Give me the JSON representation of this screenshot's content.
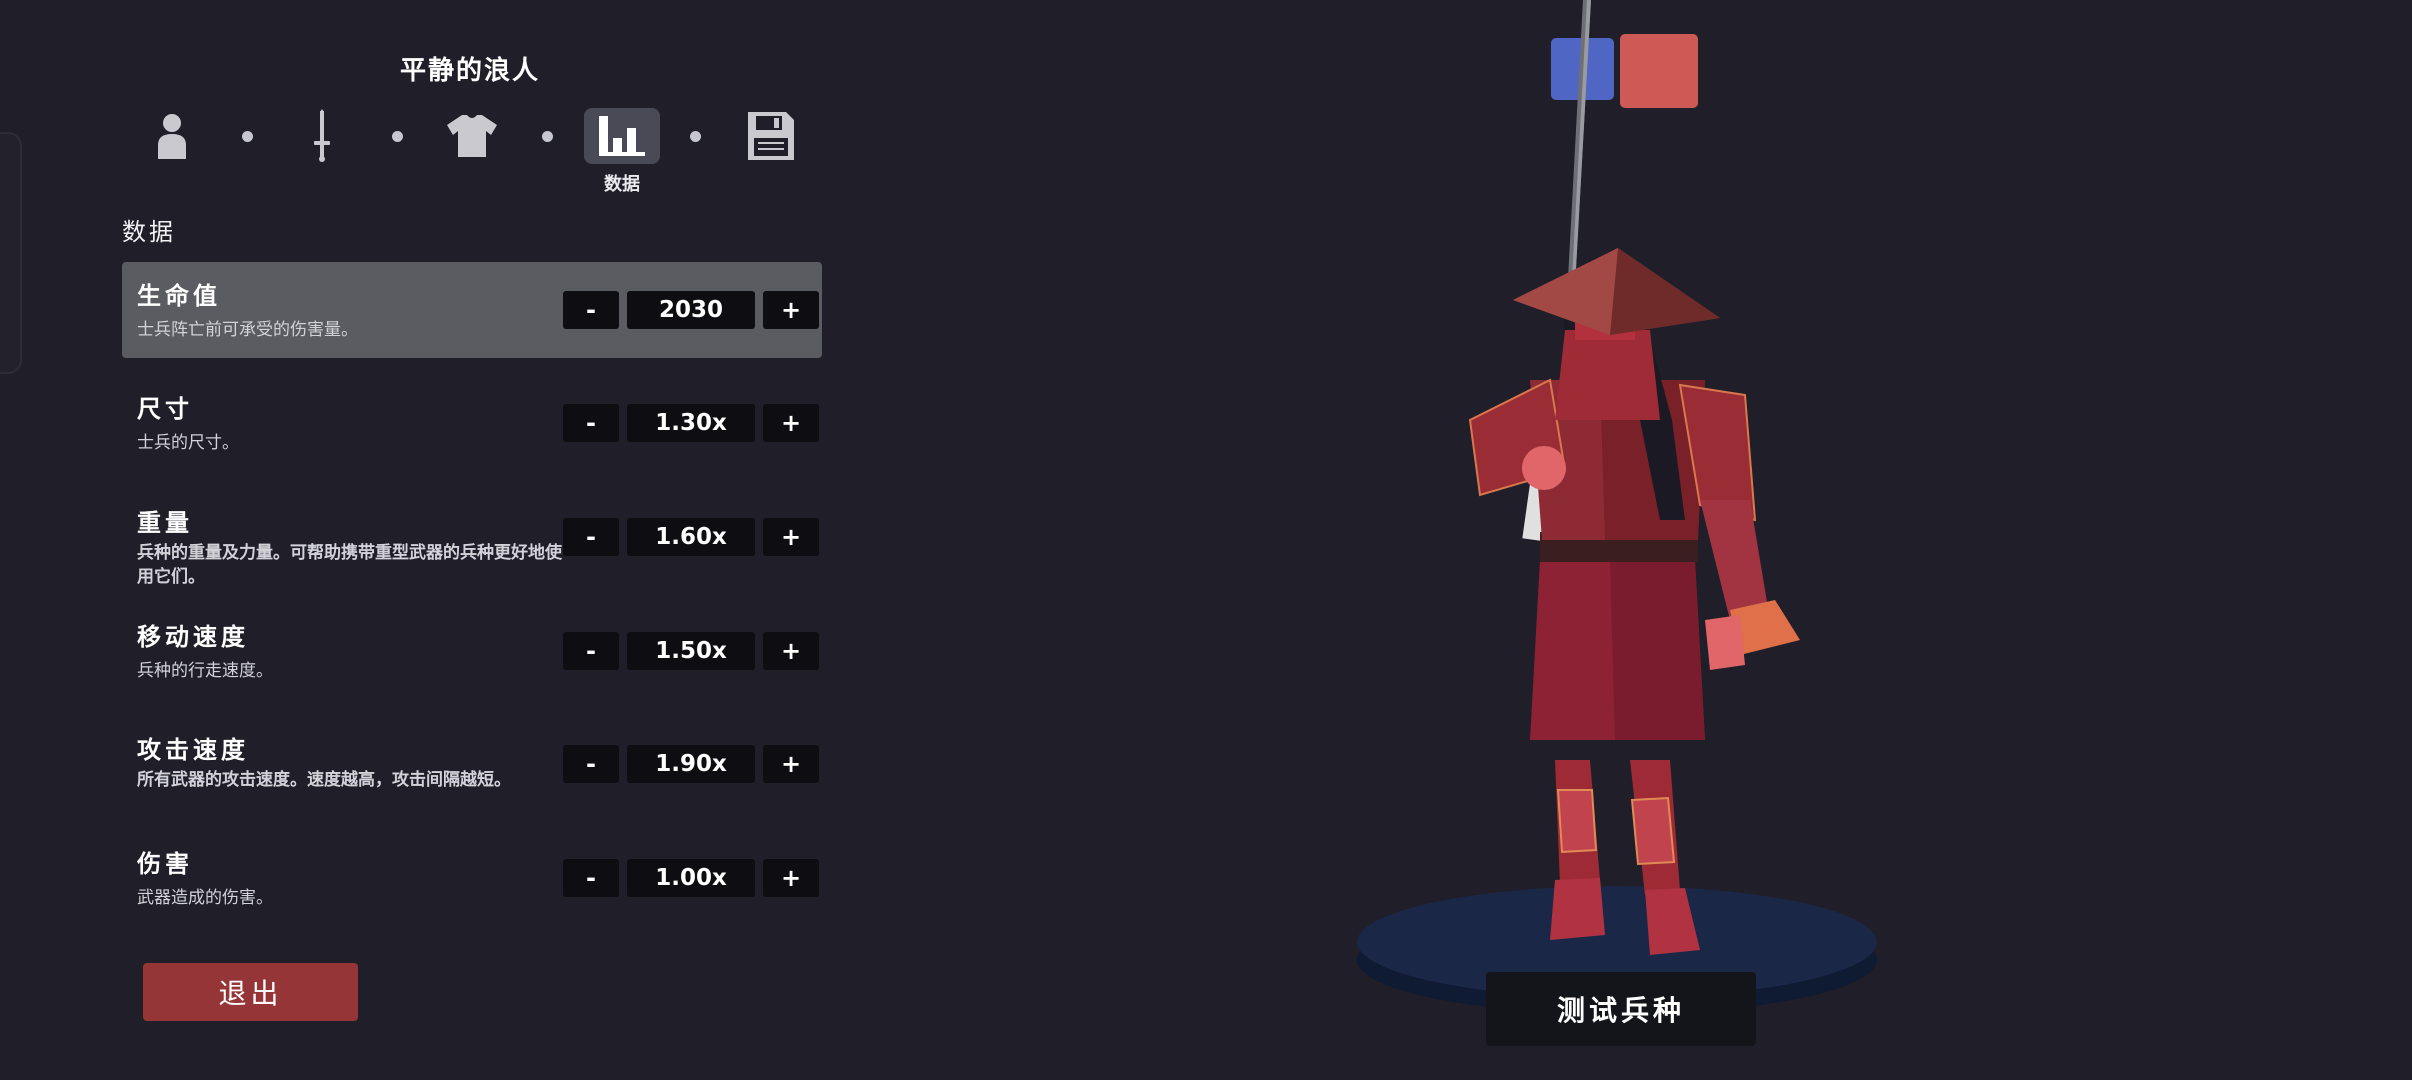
{
  "unit": {
    "title": "平静的浪人"
  },
  "nav": {
    "items": [
      {
        "icon": "person-icon",
        "label": ""
      },
      {
        "icon": "sword-icon",
        "label": ""
      },
      {
        "icon": "shirt-icon",
        "label": ""
      },
      {
        "icon": "bar-chart-icon",
        "label": "数据",
        "active": true
      },
      {
        "icon": "save-disk-icon",
        "label": ""
      }
    ]
  },
  "stats": {
    "section_label": "数据",
    "rows": [
      {
        "name": "生命值",
        "desc": "士兵阵亡前可承受的伤害量。",
        "value": "2030",
        "selected": true
      },
      {
        "name": "尺寸",
        "desc": "士兵的尺寸。",
        "value": "1.30x"
      },
      {
        "name": "重量",
        "desc": "兵种的重量及力量。可帮助携带重型武器的兵种更好地使用它们。",
        "value": "1.60x"
      },
      {
        "name": "移动速度",
        "desc": "兵种的行走速度。",
        "value": "1.50x"
      },
      {
        "name": "攻击速度",
        "desc": "所有武器的攻击速度。速度越高，攻击间隔越短。",
        "value": "1.90x"
      },
      {
        "name": "伤害",
        "desc": "武器造成的伤害。",
        "value": "1.00x"
      }
    ],
    "minus_label": "-",
    "plus_label": "+"
  },
  "actions": {
    "exit_label": "退出",
    "test_label": "测试兵种"
  },
  "teams": {
    "blue_color": "#4f66c4",
    "red_color": "#cd5a55"
  },
  "colors": {
    "background": "#1f1e29",
    "selected_row": "#5b5b62",
    "exit_button": "#963538",
    "stepper": "#0d0d12"
  }
}
